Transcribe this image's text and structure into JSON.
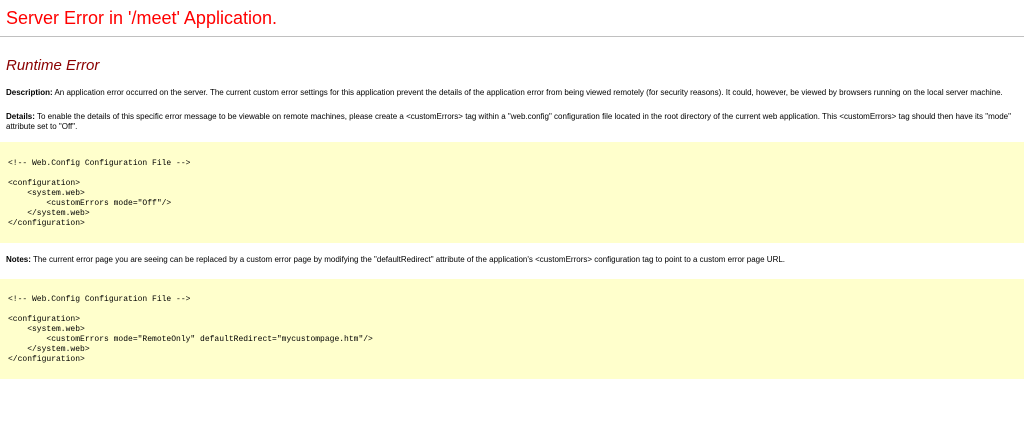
{
  "header": {
    "title": "Server Error in '/meet' Application."
  },
  "error": {
    "heading": "Runtime Error",
    "description_label": "Description:",
    "description_text": " An application error occurred on the server. The current custom error settings for this application prevent the details of the application error from being viewed remotely (for security reasons). It could, however, be viewed by browsers running on the local server machine.",
    "details_label": "Details:",
    "details_text": " To enable the details of this specific error message to be viewable on remote machines, please create a <customErrors> tag within a \"web.config\" configuration file located in the root directory of the current web application. This <customErrors> tag should then have its \"mode\" attribute set to \"Off\".",
    "notes_label": "Notes:",
    "notes_text": " The current error page you are seeing can be replaced by a custom error page by modifying the \"defaultRedirect\" attribute of the application's <customErrors> configuration tag to point to a custom error page URL."
  },
  "code_block_1": {
    "comment": "<!-- Web.Config Configuration File -->",
    "line1": "<configuration>",
    "line2": "    <system.web>",
    "line3": "        <customErrors mode=\"Off\"/>",
    "line4": "    </system.web>",
    "line5": "</configuration>"
  },
  "code_block_2": {
    "comment": "<!-- Web.Config Configuration File -->",
    "line1": "<configuration>",
    "line2": "    <system.web>",
    "line3": "        <customErrors mode=\"RemoteOnly\" defaultRedirect=\"mycustompage.htm\"/>",
    "line4": "    </system.web>",
    "line5": "</configuration>"
  },
  "colors": {
    "title": "#ff0000",
    "heading": "#8b0000",
    "code_background": "#ffffcc"
  }
}
